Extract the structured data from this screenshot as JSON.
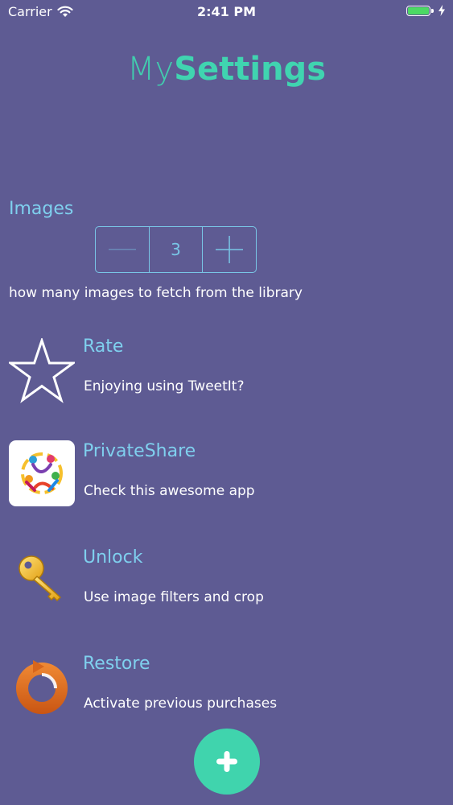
{
  "status_bar": {
    "carrier": "Carrier",
    "time": "2:41 PM",
    "battery_level": 1.0,
    "battery_color": "#4cd964"
  },
  "title": {
    "prefix": "My",
    "suffix": "Settings"
  },
  "images_setting": {
    "label": "Images",
    "value": "3",
    "description": "how many images to fetch from the library"
  },
  "items": [
    {
      "title": "Rate",
      "subtitle": "Enjoying using TweetIt?",
      "icon": "star-icon"
    },
    {
      "title": "PrivateShare",
      "subtitle": "Check this awesome app",
      "icon": "privateshare-app-icon"
    },
    {
      "title": "Unlock",
      "subtitle": "Use image filters and crop",
      "icon": "key-icon"
    },
    {
      "title": "Restore",
      "subtitle": "Activate previous purchases",
      "icon": "restore-icon"
    }
  ],
  "colors": {
    "background": "#5e5b93",
    "accent": "#40d4b0",
    "label": "#7fd0ee"
  }
}
